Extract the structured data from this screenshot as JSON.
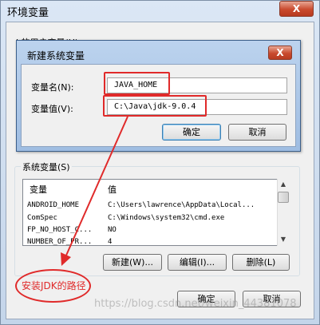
{
  "outer": {
    "title": "环境变量",
    "close_glyph": "X",
    "user_vars_label": "l     的用户变量(U)"
  },
  "dialog": {
    "title": "新建系统变量",
    "close_glyph": "X",
    "name_label": "变量名(N):",
    "name_value": "JAVA_HOME",
    "value_label": "变量值(V):",
    "value_value": "C:\\Java\\jdk-9.0.4",
    "ok_label": "确定",
    "cancel_label": "取消"
  },
  "system": {
    "group_label": "系统变量(S)",
    "columns": [
      "变量",
      "值"
    ],
    "rows": [
      {
        "name": "ANDROID_HOME",
        "value": "C:\\Users\\lawrence\\AppData\\Local..."
      },
      {
        "name": "ComSpec",
        "value": "C:\\Windows\\system32\\cmd.exe"
      },
      {
        "name": "FP_NO_HOST_C...",
        "value": "NO"
      },
      {
        "name": "NUMBER_OF_PR...",
        "value": "4"
      }
    ],
    "new_label": "新建(W)...",
    "edit_label": "编辑(I)...",
    "delete_label": "删除(L)"
  },
  "footer": {
    "ok_label": "确定",
    "cancel_label": "取消"
  },
  "annotation": {
    "text": "安装JDK的路径"
  },
  "watermark": "https://blog.csdn.net/weixin_44381078",
  "colors": {
    "annotation_red": "#e02a2a",
    "title_bar": "#bcd3ee",
    "close_button": "#c94a2e"
  }
}
